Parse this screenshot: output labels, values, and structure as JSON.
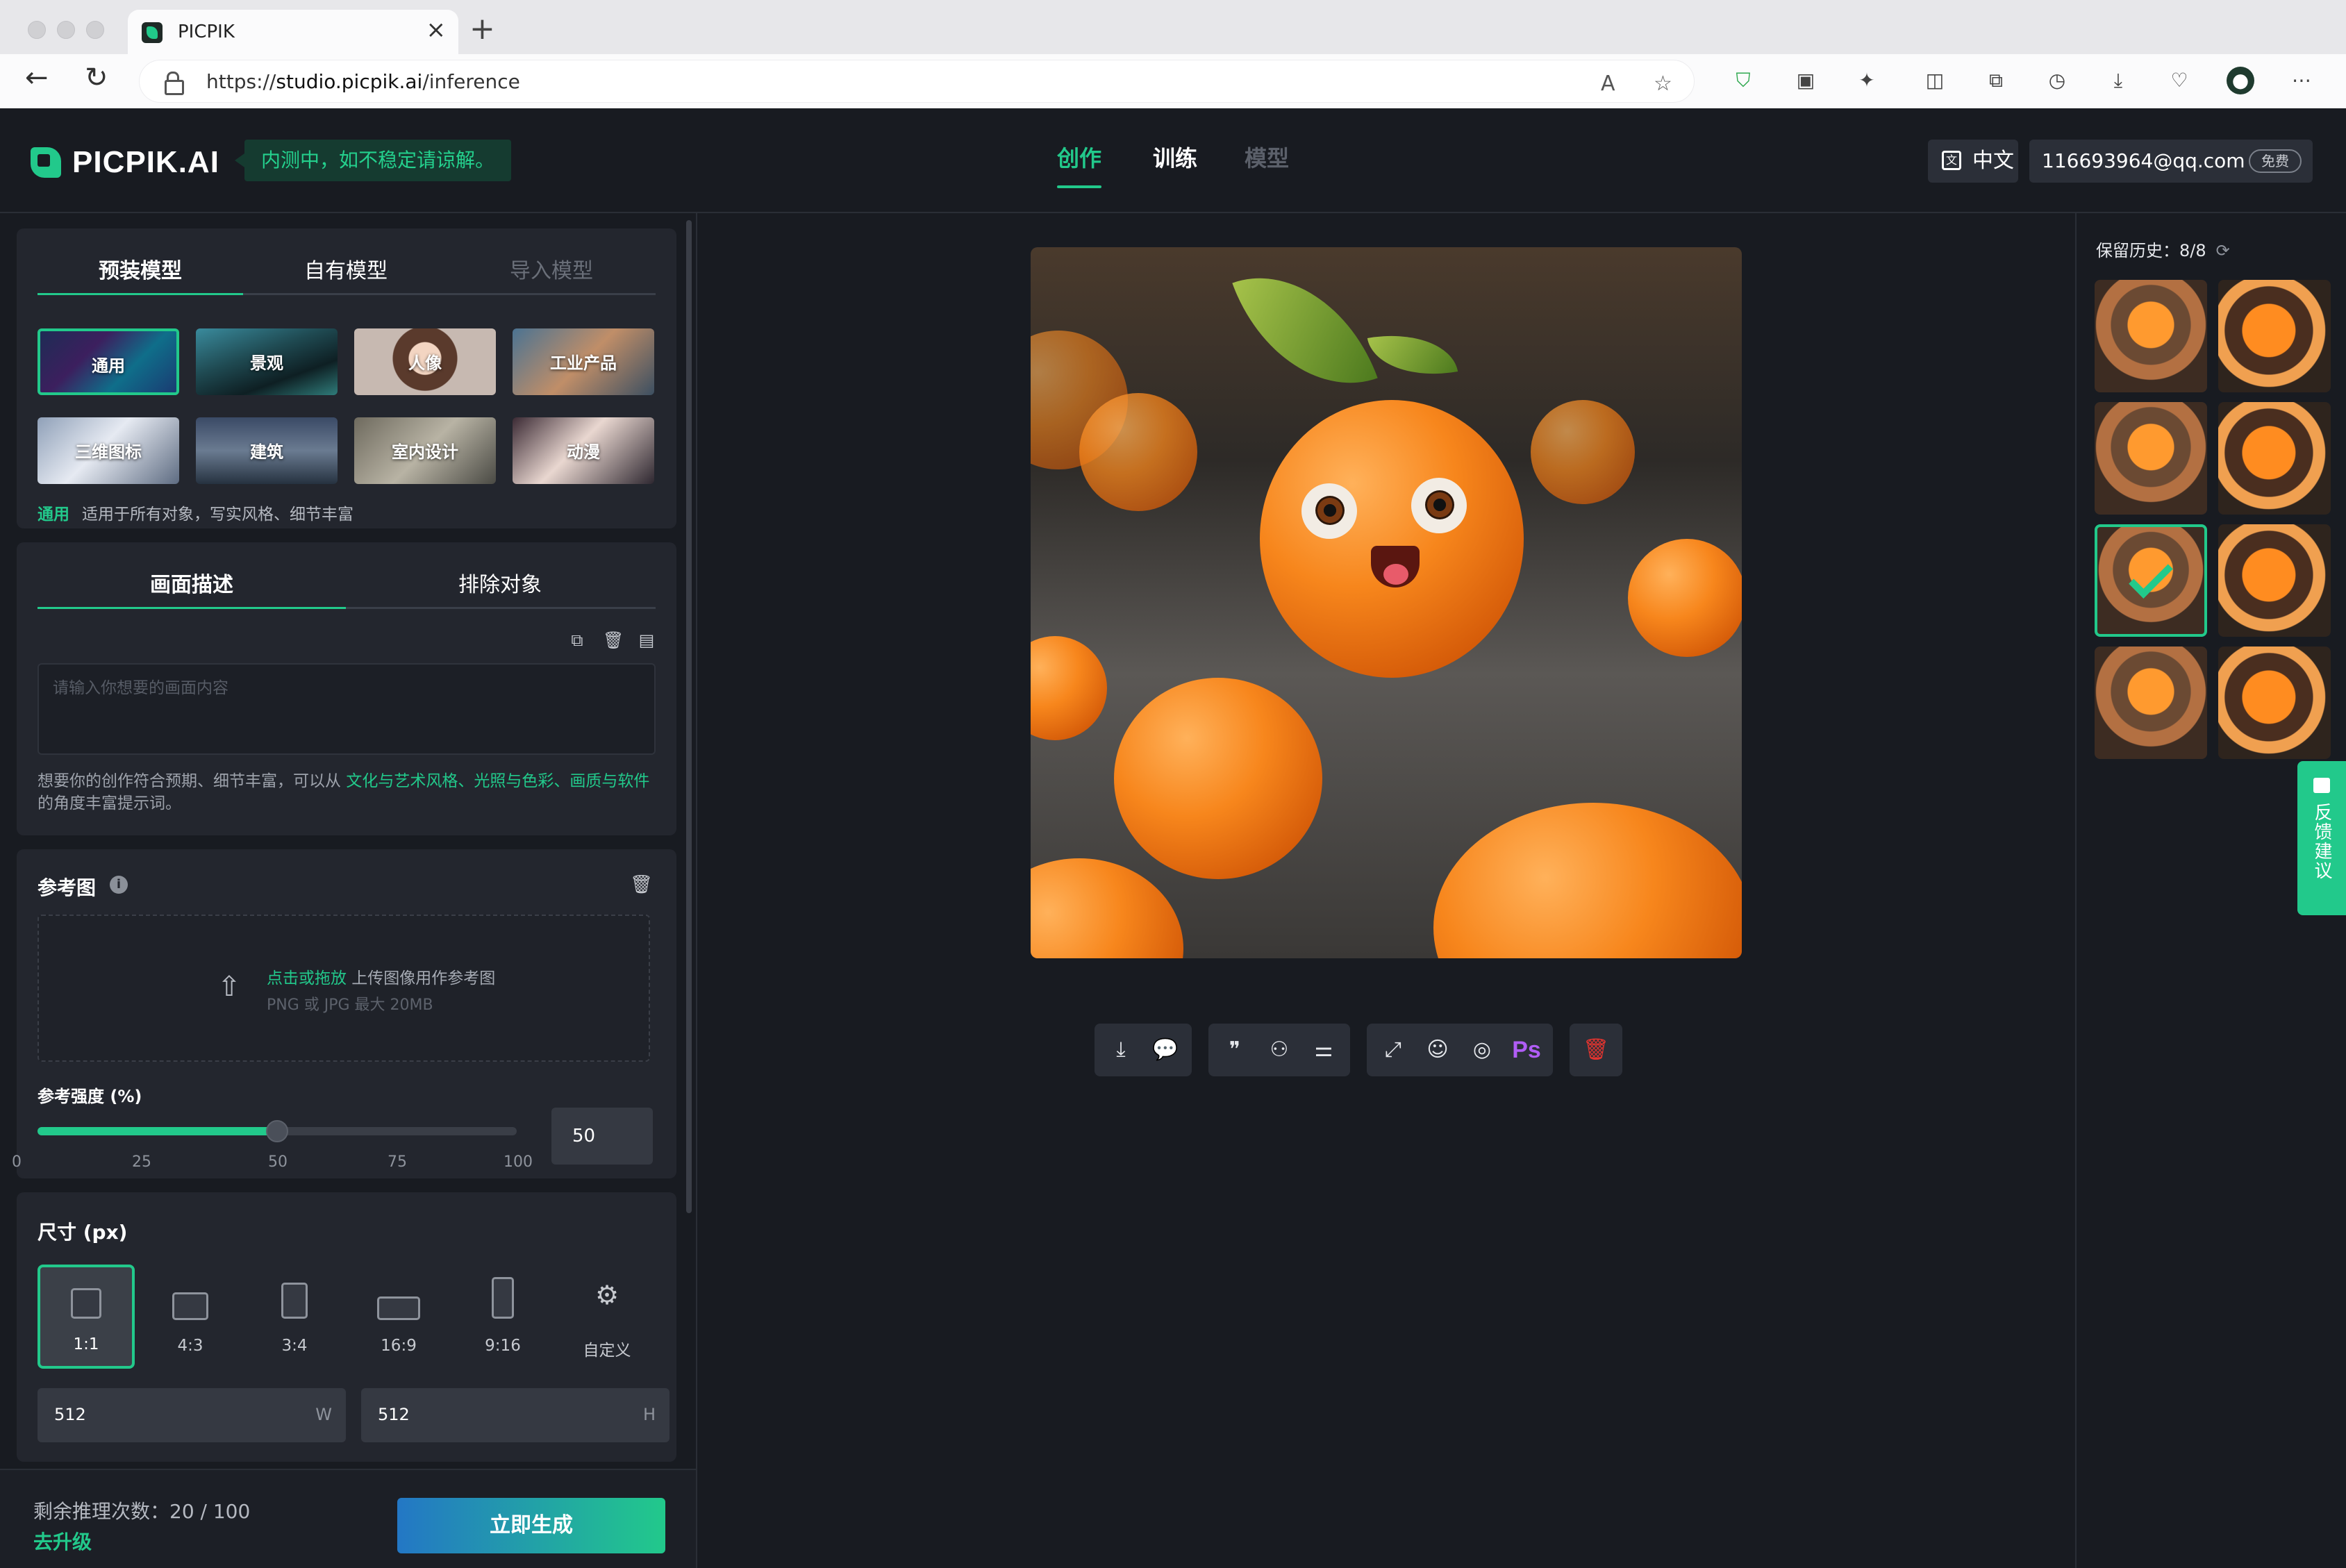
{
  "browser": {
    "tab_title": "PICPIK",
    "tab_close": "×",
    "new_tab": "+",
    "url_prefix": "https://",
    "url_host": "studio.picpik.ai",
    "url_path": "/inference"
  },
  "header": {
    "logo_text": "PICPIK.AI",
    "beta_notice": "内测中，如不稳定请谅解。",
    "nav": {
      "create": "创作",
      "train": "训练",
      "models": "模型"
    },
    "language": "中文",
    "user_email": "116693964@qq.com",
    "plan_badge": "免费"
  },
  "model_panel": {
    "tabs": [
      "预装模型",
      "自有模型",
      "导入模型"
    ],
    "models": [
      "通用",
      "景观",
      "人像",
      "工业产品",
      "三维图标",
      "建筑",
      "室内设计",
      "动漫"
    ],
    "selected_name": "通用",
    "selected_desc": "适用于所有对象，写实风格、细节丰富"
  },
  "prompt_panel": {
    "tabs": [
      "画面描述",
      "排除对象"
    ],
    "placeholder": "请输入你想要的画面内容",
    "hint_prefix": "想要你的创作符合预期、细节丰富，可以从 ",
    "hint_link1": "文化与艺术风格",
    "hint_sep1": "、",
    "hint_link2": "光照与色彩",
    "hint_sep2": "、",
    "hint_link3": "画质与软件",
    "hint_suffix": " 的角度丰富提示词。"
  },
  "reference_panel": {
    "title": "参考图",
    "upload_link": "点击或拖放",
    "upload_text": " 上传图像用作参考图",
    "upload_formats": "PNG 或 JPG 最大 20MB",
    "strength_label": "参考强度 (%)",
    "strength_value": 50,
    "strength_value_text": "50",
    "ticks": [
      "0",
      "25",
      "50",
      "75",
      "100"
    ]
  },
  "size_panel": {
    "title": "尺寸 (px)",
    "ratios": [
      "1:1",
      "4:3",
      "3:4",
      "16:9",
      "9:16",
      "自定义"
    ],
    "selected_ratio": "1:1",
    "width": "512",
    "width_unit": "W",
    "height": "512",
    "height_unit": "H"
  },
  "footer": {
    "remaining": "剩余推理次数：20 / 100",
    "upgrade": "去升级",
    "generate": "立即生成"
  },
  "toolbar": {
    "icons": [
      "download-icon",
      "wechat-icon",
      "quote-icon",
      "circles-icon",
      "adjust-icon",
      "expand-icon",
      "face-icon",
      "filter-icon",
      "photoshop-icon",
      "trash-icon"
    ],
    "ps_label": "Ps"
  },
  "history": {
    "title": "保留历史：8/8",
    "count": 8,
    "selected_index": 4
  },
  "feedback": {
    "label": "反馈建议"
  },
  "colors": {
    "accent": "#22c98b",
    "background": "#181b21",
    "panel": "#23262e",
    "danger": "#e3342f",
    "ps": "#b05df5"
  }
}
